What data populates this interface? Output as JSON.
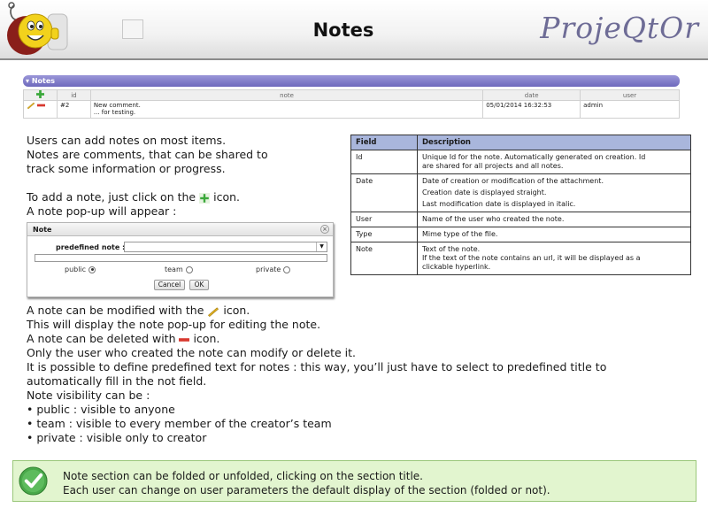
{
  "header": {
    "title": "Notes",
    "brand": "ProjeQtOr"
  },
  "notes_section": {
    "title": "Notes",
    "columns": [
      "",
      "id",
      "note",
      "date",
      "user"
    ],
    "rows": [
      {
        "id": "#2",
        "note_line1": "New comment.",
        "note_line2": "... for testing.",
        "date": "05/01/2014 16:32:53",
        "user": "admin"
      }
    ]
  },
  "intro": {
    "line1": "Users can add notes on most items.",
    "line2": "Notes are comments, that can be shared to",
    "line3": "track some information or progress.",
    "add_prefix": "To add a note, just click on the",
    "add_suffix": "icon.",
    "popup_line": "A note pop-up will appear :"
  },
  "popup": {
    "title": "Note",
    "predefined_label": "predefined note :",
    "radio_public": "public",
    "radio_team": "team",
    "radio_private": "private",
    "selected_visibility": "public",
    "cancel_label": "Cancel",
    "ok_label": "OK"
  },
  "field_table": {
    "headers": [
      "Field",
      "Description"
    ],
    "rows": [
      {
        "field": "Id",
        "desc1": "Unique Id for the note. Automatically generated on creation. Id",
        "desc2": "are shared for all projects and all notes."
      },
      {
        "field": "Date",
        "desc1": "Date of creation or modification of the attachment.",
        "desc2": "Creation date is displayed straight.",
        "desc3": "Last modification date is displayed in italic."
      },
      {
        "field": "User",
        "desc1": "Name of the user who created the note."
      },
      {
        "field": "Type",
        "desc1": "Mime type of the file."
      },
      {
        "field": "Note",
        "desc1": "Text of the note.",
        "desc2": "If the text of the note contains an url, it will be displayed as a",
        "desc3": "clickable hyperlink."
      }
    ]
  },
  "body2": {
    "modify_prefix": "A note can be modified with the",
    "modify_suffix": "icon.",
    "line_display": "This will display the note pop-up for editing the note.",
    "delete_prefix": "A note can be deleted with",
    "delete_suffix": "icon.",
    "line_only": "Only the user who created the note can modify or delete it.",
    "line_predef1": "It is possible to define predefined text for notes : this way, you’ll just have to select to predefined title to",
    "line_predef2": "automatically fill in the not field.",
    "line_visibility": "Note visibility can be :",
    "bullet_public": "• public : visible to anyone",
    "bullet_team": "• team : visible to every member of the creator’s team",
    "bullet_private": "• private : visible only to creator"
  },
  "tip": {
    "line1": "Note section can be folded or unfolded, clicking on the section title.",
    "line2": "Each user can change on user parameters the default display of the section (folded or not)."
  },
  "icons": {
    "add": "plus-icon",
    "edit": "pencil-icon",
    "delete": "minus-icon",
    "tip": "check-icon",
    "logo": "mascot-logo",
    "close": "close-icon"
  },
  "colors": {
    "section_bar": "#7e79c8",
    "brand": "#6e6c96",
    "table_header": "#a9b6dc",
    "tip_bg": "#e2f5cf",
    "add_icon": "#3aa83a",
    "delete_icon": "#d8382e"
  }
}
